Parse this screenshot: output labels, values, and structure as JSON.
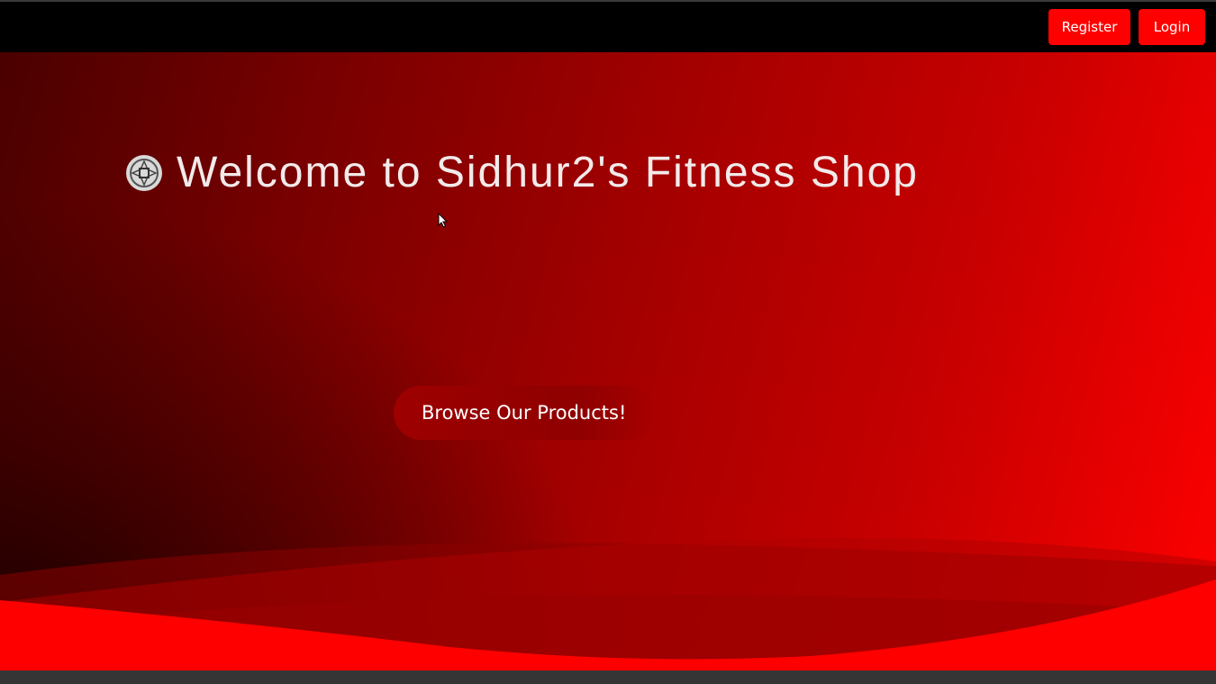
{
  "header": {
    "register_label": "Register",
    "login_label": "Login"
  },
  "hero": {
    "title": "Welcome to Sidhur2's Fitness Shop",
    "browse_label": "Browse Our Products!"
  },
  "colors": {
    "accent": "#ff0000",
    "topbar": "#000000",
    "title_text": "#f3eaea"
  },
  "icons": {
    "logo": "shop-logo-icon",
    "cursor": "mouse-cursor-icon"
  }
}
